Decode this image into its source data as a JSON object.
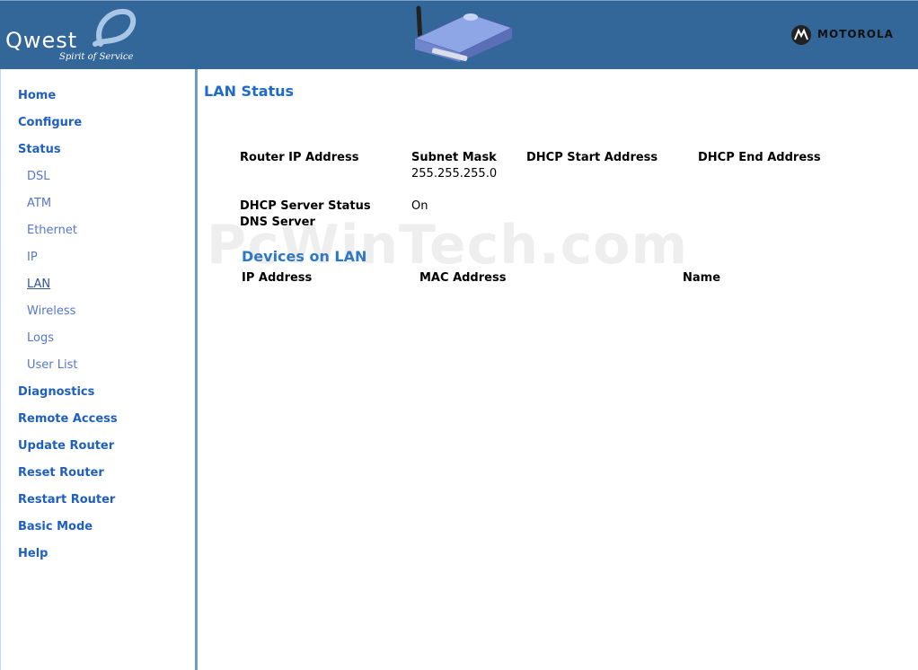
{
  "header": {
    "brand": "Qwest",
    "tagline": "Spirit of Service",
    "partner": "MOTOROLA"
  },
  "sidebar": {
    "items": [
      {
        "label": "Home",
        "level": 1
      },
      {
        "label": "Configure",
        "level": 1
      },
      {
        "label": "Status",
        "level": 1
      },
      {
        "label": "DSL",
        "level": 2
      },
      {
        "label": "ATM",
        "level": 2
      },
      {
        "label": "Ethernet",
        "level": 2
      },
      {
        "label": "IP",
        "level": 2
      },
      {
        "label": "LAN",
        "level": 2,
        "active": true
      },
      {
        "label": "Wireless",
        "level": 2
      },
      {
        "label": "Logs",
        "level": 2
      },
      {
        "label": "User List",
        "level": 2
      },
      {
        "label": "Diagnostics",
        "level": 1
      },
      {
        "label": "Remote Access",
        "level": 1
      },
      {
        "label": "Update Router",
        "level": 1
      },
      {
        "label": "Reset Router",
        "level": 1
      },
      {
        "label": "Restart Router",
        "level": 1
      },
      {
        "label": "Basic Mode",
        "level": 1
      },
      {
        "label": "Help",
        "level": 1
      }
    ]
  },
  "main": {
    "title": "LAN Status",
    "lan": {
      "router_ip_label": "Router IP Address",
      "subnet_label": "Subnet Mask",
      "subnet_value": "255.255.255.0",
      "dhcp_start_label": "DHCP Start Address",
      "dhcp_end_label": "DHCP End Address",
      "dhcp_status_label": "DHCP Server Status",
      "dhcp_status_value": "On",
      "dns_label": "DNS Server"
    },
    "devices": {
      "title": "Devices on LAN",
      "columns": [
        "IP Address",
        "MAC Address",
        "Name"
      ]
    }
  },
  "watermark": "PcWinTech.com",
  "colors": {
    "header_bg": "#336699",
    "link": "#1f5fbf",
    "title": "#1f6bc9"
  }
}
